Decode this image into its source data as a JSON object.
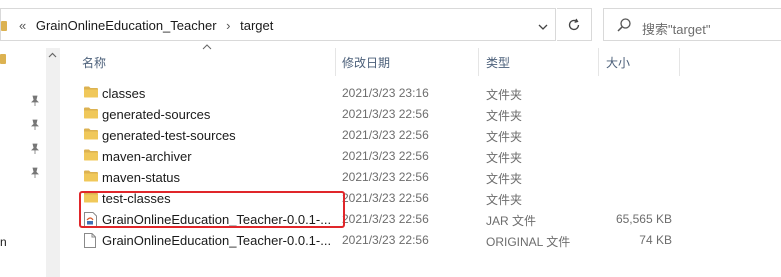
{
  "address_bar": {
    "overflow_marker": "«",
    "segments": [
      "GrainOnlineEducation_Teacher",
      "target"
    ],
    "separator": "›"
  },
  "search": {
    "placeholder": "搜索\"target\""
  },
  "nav": {
    "truncated_label": "n"
  },
  "columns": {
    "name": "名称",
    "date": "修改日期",
    "type": "类型",
    "size": "大小"
  },
  "files": [
    {
      "icon": "folder-icon",
      "name": "classes",
      "date": "2021/3/23 23:16",
      "type": "文件夹",
      "size": ""
    },
    {
      "icon": "folder-icon",
      "name": "generated-sources",
      "date": "2021/3/23 22:56",
      "type": "文件夹",
      "size": ""
    },
    {
      "icon": "folder-icon",
      "name": "generated-test-sources",
      "date": "2021/3/23 22:56",
      "type": "文件夹",
      "size": ""
    },
    {
      "icon": "folder-icon",
      "name": "maven-archiver",
      "date": "2021/3/23 22:56",
      "type": "文件夹",
      "size": ""
    },
    {
      "icon": "folder-icon",
      "name": "maven-status",
      "date": "2021/3/23 22:56",
      "type": "文件夹",
      "size": ""
    },
    {
      "icon": "folder-icon",
      "name": "test-classes",
      "date": "2021/3/23 22:56",
      "type": "文件夹",
      "size": ""
    },
    {
      "icon": "jar-file-icon",
      "name": "GrainOnlineEducation_Teacher-0.0.1-...",
      "date": "2021/3/23 22:56",
      "type": "JAR 文件",
      "size": "65,565 KB"
    },
    {
      "icon": "file-icon",
      "name": "GrainOnlineEducation_Teacher-0.0.1-...",
      "date": "2021/3/23 22:56",
      "type": "ORIGINAL 文件",
      "size": "74 KB"
    }
  ],
  "colors": {
    "folder": "#dcb251",
    "highlight": "#e0262a",
    "header_text": "#4c607a"
  }
}
